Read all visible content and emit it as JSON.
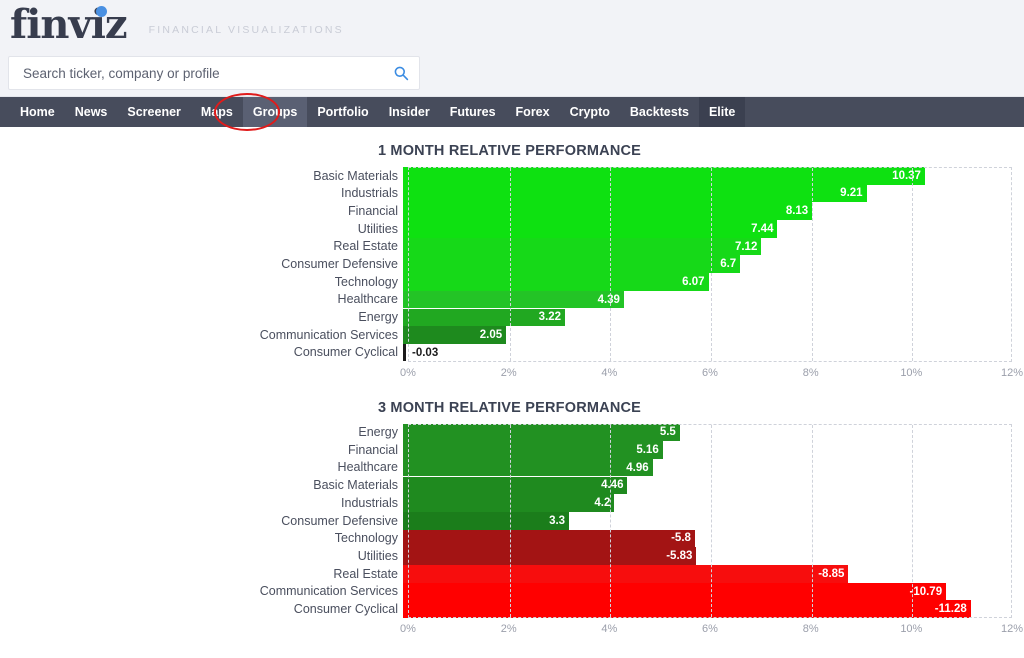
{
  "header": {
    "logo_text": "finviz",
    "tagline": "FINANCIAL VISUALIZATIONS",
    "logo_color": "#383d4e",
    "logo_dot_color": "#4a90e2"
  },
  "search": {
    "placeholder": "Search ticker, company or profile",
    "value": "",
    "icon": "search-icon",
    "icon_color": "#3b8ce2"
  },
  "nav": {
    "background": "#474c5c",
    "active_item": "Groups",
    "annotation": "red-ellipse-highlight",
    "annotation_color": "#e01b1b",
    "items": [
      {
        "label": "Home",
        "active": false,
        "elite": false
      },
      {
        "label": "News",
        "active": false,
        "elite": false
      },
      {
        "label": "Screener",
        "active": false,
        "elite": false
      },
      {
        "label": "Maps",
        "active": false,
        "elite": false
      },
      {
        "label": "Groups",
        "active": true,
        "elite": false
      },
      {
        "label": "Portfolio",
        "active": false,
        "elite": false
      },
      {
        "label": "Insider",
        "active": false,
        "elite": false
      },
      {
        "label": "Futures",
        "active": false,
        "elite": false
      },
      {
        "label": "Forex",
        "active": false,
        "elite": false
      },
      {
        "label": "Crypto",
        "active": false,
        "elite": false
      },
      {
        "label": "Backtests",
        "active": false,
        "elite": false
      },
      {
        "label": "Elite",
        "active": false,
        "elite": true
      }
    ]
  },
  "chart_data": [
    {
      "type": "bar",
      "orientation": "horizontal",
      "title": "1 MONTH RELATIVE PERFORMANCE",
      "xlabel": "",
      "ylabel": "",
      "xlim": [
        0,
        12
      ],
      "xticks": [
        "0%",
        "2%",
        "4%",
        "6%",
        "8%",
        "10%",
        "12%"
      ],
      "xtick_values": [
        0,
        2,
        4,
        6,
        8,
        10,
        12
      ],
      "grid": true,
      "legend": "none",
      "categories": [
        "Basic Materials",
        "Industrials",
        "Financial",
        "Utilities",
        "Real Estate",
        "Consumer Defensive",
        "Technology",
        "Healthcare",
        "Energy",
        "Communication Services",
        "Consumer Cyclical"
      ],
      "values": [
        10.37,
        9.21,
        8.13,
        7.44,
        7.12,
        6.7,
        6.07,
        4.39,
        3.22,
        2.05,
        -0.03
      ],
      "labels": [
        "10.37",
        "9.21",
        "8.13",
        "7.44",
        "7.12",
        "6.7",
        "6.07",
        "4.39",
        "3.22",
        "2.05",
        "-0.03"
      ],
      "colors": [
        "#0ee111",
        "#0ee111",
        "#0ee111",
        "#0ee111",
        "#16d918",
        "#16d918",
        "#16d918",
        "#23c426",
        "#21a821",
        "#1e8a1e",
        "#1b1b1b"
      ]
    },
    {
      "type": "bar",
      "orientation": "horizontal",
      "title": "3 MONTH RELATIVE PERFORMANCE",
      "xlabel": "",
      "ylabel": "",
      "xlim": [
        0,
        12
      ],
      "xticks": [
        "0%",
        "2%",
        "4%",
        "6%",
        "8%",
        "10%",
        "12%"
      ],
      "xtick_values": [
        0,
        2,
        4,
        6,
        8,
        10,
        12
      ],
      "grid": true,
      "legend": "none",
      "categories": [
        "Energy",
        "Financial",
        "Healthcare",
        "Basic Materials",
        "Industrials",
        "Consumer Defensive",
        "Technology",
        "Utilities",
        "Real Estate",
        "Communication Services",
        "Consumer Cyclical"
      ],
      "values": [
        5.5,
        5.16,
        4.96,
        4.46,
        4.2,
        3.3,
        -5.8,
        -5.83,
        -8.85,
        -10.79,
        -11.28
      ],
      "labels": [
        "5.5",
        "5.16",
        "4.96",
        "4.46",
        "4.2",
        "3.3",
        "-5.8",
        "-5.83",
        "-8.85",
        "-10.79",
        "-11.28"
      ],
      "colors": [
        "#229122",
        "#229122",
        "#229122",
        "#1f8a1f",
        "#1f8a1f",
        "#1b7d1b",
        "#a31414",
        "#a31414",
        "#f70d0d",
        "#ff0000",
        "#ff0000"
      ]
    }
  ]
}
